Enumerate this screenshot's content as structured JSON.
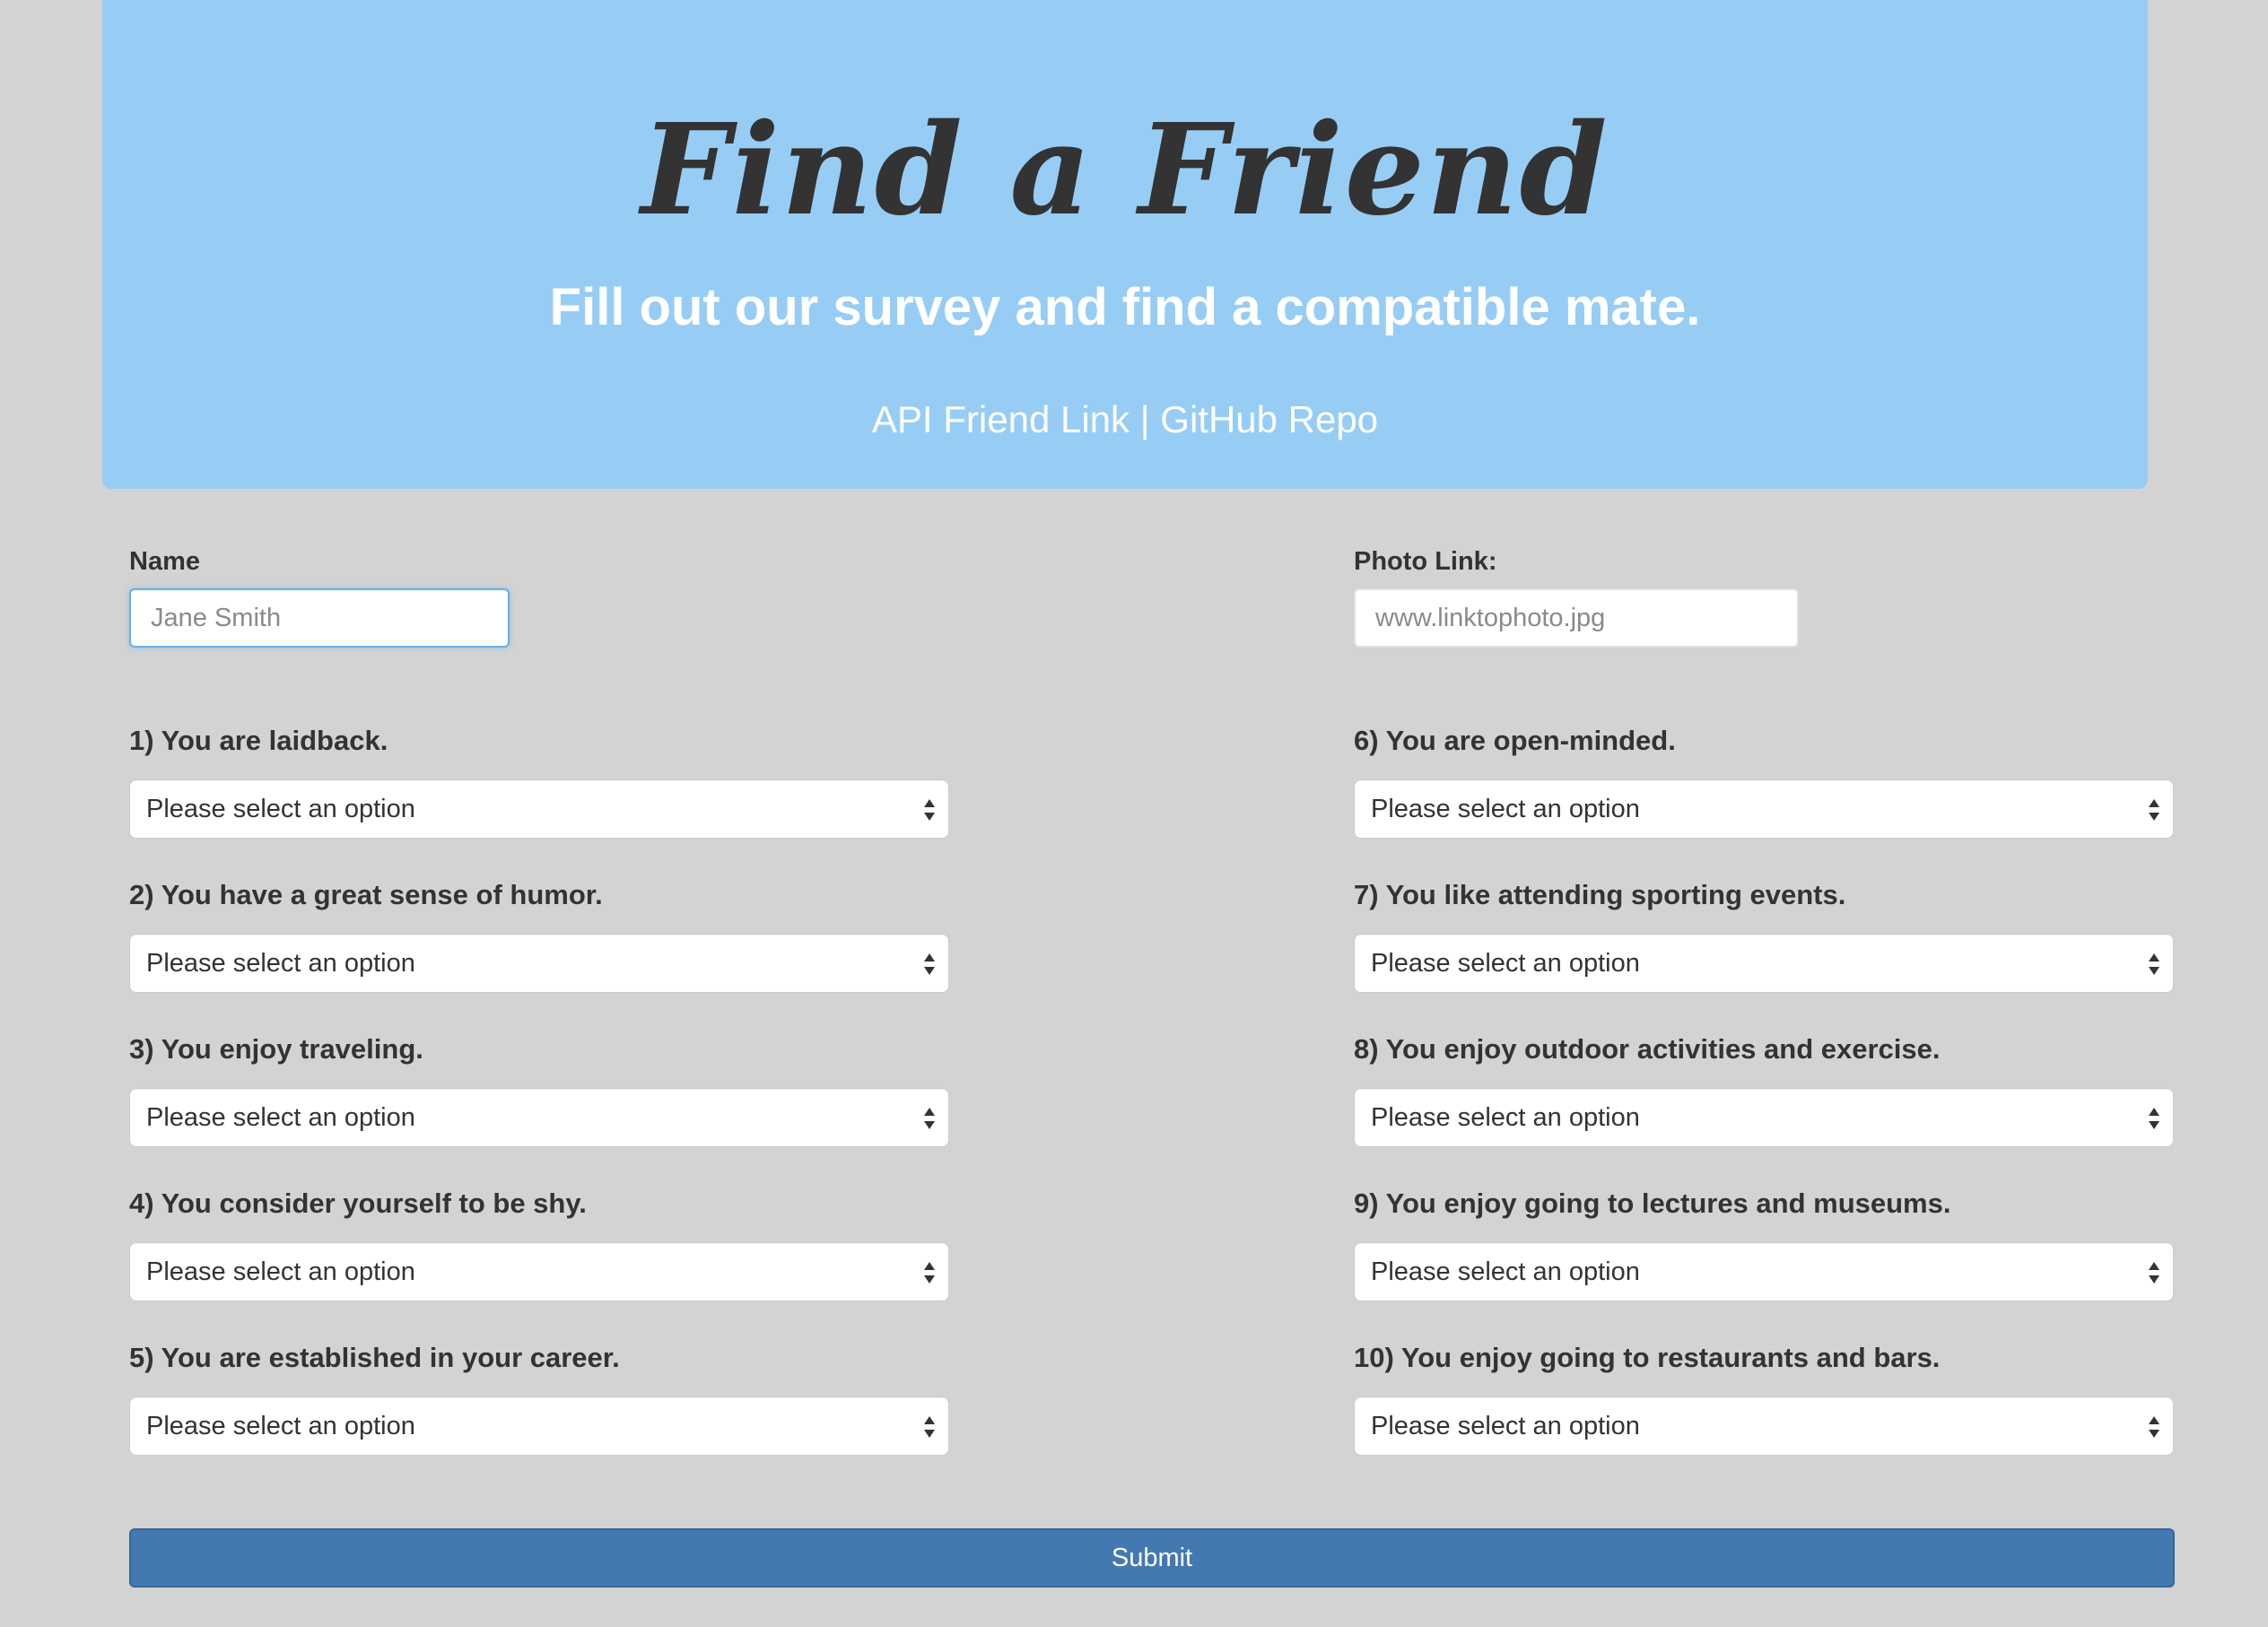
{
  "header": {
    "title": "Find a Friend",
    "subtitle": "Fill out our survey and find a compatible mate.",
    "api_link": "API Friend Link",
    "separator": " | ",
    "github_link": "GitHub Repo"
  },
  "form": {
    "name_label": "Name",
    "name_placeholder": "Jane Smith",
    "photo_label": "Photo Link:",
    "photo_placeholder": "www.linktophoto.jpg",
    "select_placeholder": "Please select an option",
    "questions": [
      "1) You are laidback.",
      "2) You have a great sense of humor.",
      "3) You enjoy traveling.",
      "4) You consider yourself to be shy.",
      "5) You are established in your career.",
      "6) You are open-minded.",
      "7) You like attending sporting events.",
      "8) You enjoy outdoor activities and exercise.",
      "9) You enjoy going to lectures and museums.",
      "10) You enjoy going to restaurants and bars."
    ],
    "submit_label": "Submit"
  },
  "colors": {
    "page_background": "#d3d3d3",
    "header_background": "#97cdf5",
    "submit_background": "#4379b0"
  }
}
